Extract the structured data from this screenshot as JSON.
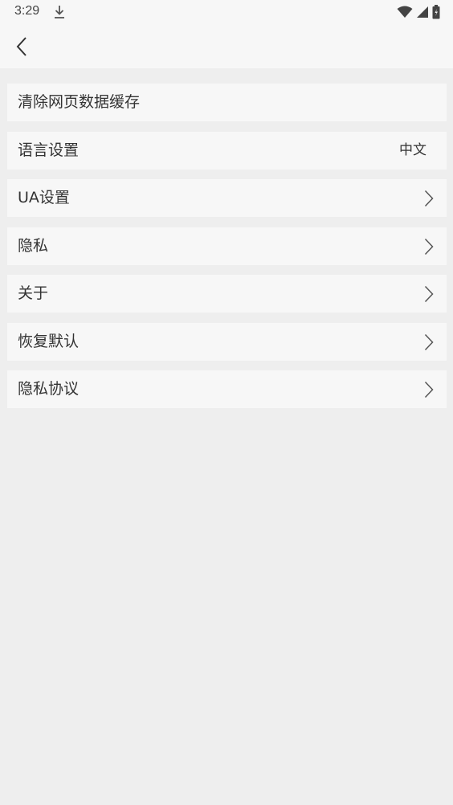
{
  "status_bar": {
    "time": "3:29"
  },
  "icons": {
    "download": "download-icon",
    "wifi": "wifi-icon",
    "signal": "cell-signal-icon",
    "battery": "battery-icon",
    "back": "chevron-left-icon",
    "chevron": "chevron-right-icon"
  },
  "settings": {
    "items": [
      {
        "label": "清除网页数据缓存"
      },
      {
        "label": "语言设置",
        "value": "中文"
      },
      {
        "label": "UA设置"
      },
      {
        "label": "隐私"
      },
      {
        "label": "关于"
      },
      {
        "label": "恢复默认"
      },
      {
        "label": "隐私协议"
      }
    ]
  },
  "colors": {
    "background": "#eeeeee",
    "surface": "#f7f7f7",
    "text": "#333333"
  }
}
